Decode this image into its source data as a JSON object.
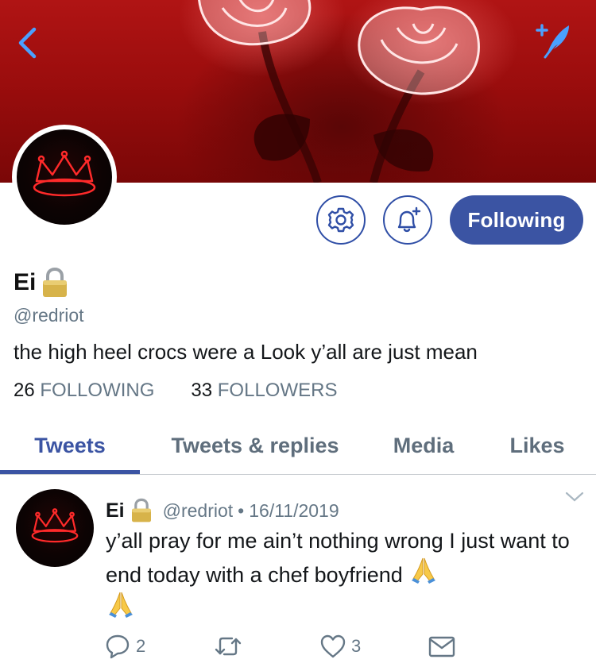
{
  "profile": {
    "display_name": "Ei",
    "handle": "@redriot",
    "bio": "the high heel crocs were a Look y’all are just mean",
    "following_count": "26",
    "following_label": "FOLLOWING",
    "followers_count": "33",
    "followers_label": "FOLLOWERS"
  },
  "actions": {
    "following_button": "Following"
  },
  "tabs": [
    {
      "label": "Tweets",
      "active": true
    },
    {
      "label": "Tweets & replies",
      "active": false
    },
    {
      "label": "Media",
      "active": false
    },
    {
      "label": "Likes",
      "active": false
    }
  ],
  "tweet": {
    "name": "Ei",
    "handle": "@redriot",
    "date": "16/11/2019",
    "text": "y’all pray for me ain’t nothing wrong I just want to end today with a chef boyfriend",
    "reply_count": "2",
    "like_count": "3"
  },
  "colors": {
    "accent": "#3b54a3",
    "secondary_text": "#657786",
    "banner_red": "#9b0d0d"
  },
  "icons": {
    "back": "chevron-left-icon",
    "compose": "compose-feather-icon",
    "settings": "gear-icon",
    "notifications": "bell-plus-icon",
    "lock": "lock-icon",
    "reply": "reply-icon",
    "retweet": "retweet-icon",
    "like": "heart-icon",
    "dm": "envelope-icon",
    "caret": "chevron-down-icon"
  }
}
